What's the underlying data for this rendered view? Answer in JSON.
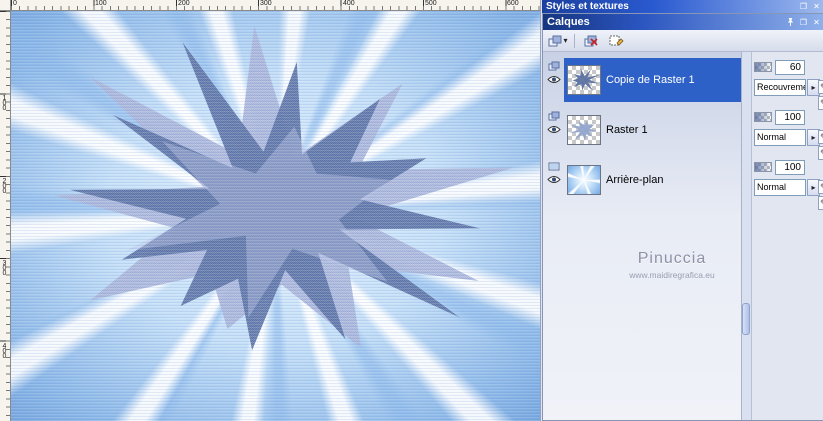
{
  "icons": {
    "close": "✕",
    "float": "❐",
    "dropdown_arrow": "▾",
    "blend_arrow": "▸",
    "pencil": "✎"
  },
  "back_palette": {
    "title": "Styles et textures"
  },
  "palette": {
    "title": "Calques",
    "layers": [
      {
        "name": "Copie de Raster 1",
        "opacity": "60",
        "blend_mode": "Recouvrement",
        "selected": true,
        "visible": true
      },
      {
        "name": "Raster 1",
        "opacity": "100",
        "blend_mode": "Normal",
        "selected": false,
        "visible": true
      },
      {
        "name": "Arrière-plan",
        "opacity": "100",
        "blend_mode": "Normal",
        "selected": false,
        "visible": true
      }
    ],
    "watermark": {
      "name": "Pinuccia",
      "url": "www.maidiregrafica.eu"
    }
  },
  "rulers": {
    "top": [
      "0",
      "100",
      "200",
      "300",
      "400",
      "500",
      "600"
    ],
    "left": [
      "100",
      "200",
      "300",
      "400"
    ]
  }
}
